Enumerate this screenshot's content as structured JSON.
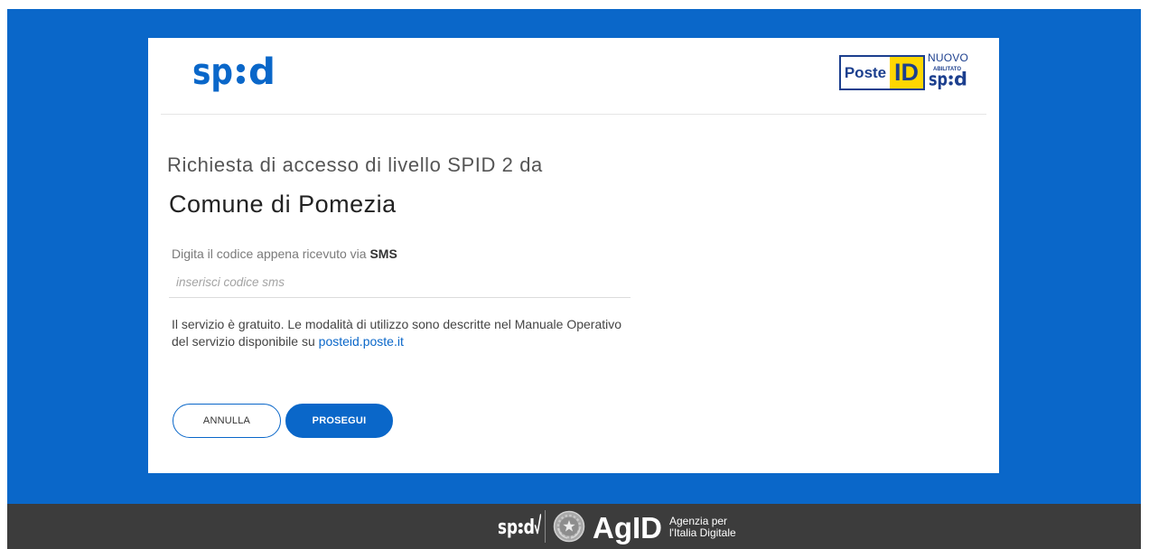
{
  "header": {
    "spid_logo": "spid",
    "poste_id_logo": {
      "poste": "Poste",
      "id": "ID",
      "badge_top": "NUOVO",
      "badge_middle": "ABILITATO",
      "spid_logo": "spid"
    }
  },
  "request": {
    "intro": "Richiesta di accesso di livello SPID 2 da",
    "service_provider": "Comune di Pomezia"
  },
  "form": {
    "label_text": "Digita il codice appena ricevuto via",
    "label_channel": "SMS",
    "code_input": {
      "value": "",
      "placeholder": "inserisci codice sms"
    }
  },
  "info": {
    "line1": "Il servizio è gratuito. Le modalità di utilizzo sono descritte nel Manuale Operativo",
    "line2": "del servizio disponibile su",
    "link": "posteid.poste.it"
  },
  "actions": {
    "cancel": "ANNULLA",
    "continue": "PROSEGUI"
  },
  "footer": {
    "spid_logo": "spid",
    "agid_logo": "AgID",
    "agid_line1": "Agenzia per",
    "agid_line2": "l'Italia Digitale"
  },
  "icons": {
    "footer_spid_mark": "check-icon",
    "footer_emblem": "emblem-icon"
  },
  "colors": {
    "brand_blue": "#0a67c9",
    "footer_bg": "#3c3c3c",
    "poste_blue": "#1c3f8e",
    "poste_yellow": "#ffd700"
  }
}
